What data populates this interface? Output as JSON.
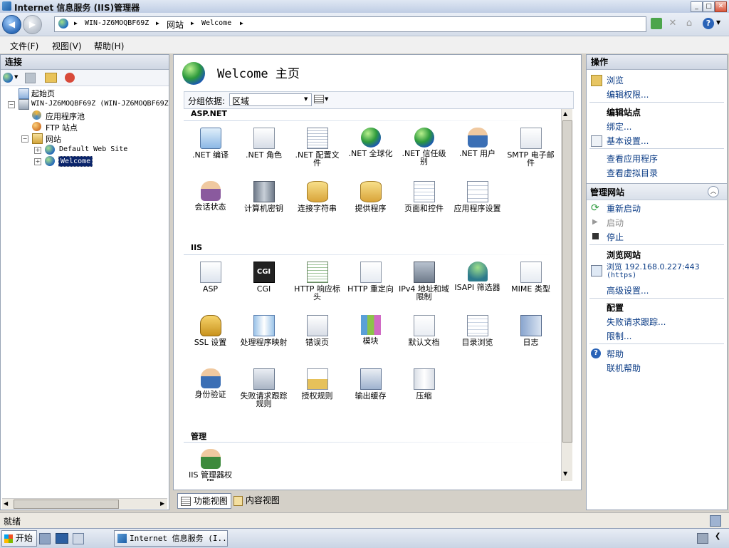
{
  "window": {
    "title": "Internet 信息服务 (IIS)管理器"
  },
  "address": {
    "segments": [
      "WIN-JZ6MOQBF69Z",
      "网站",
      "Welcome"
    ]
  },
  "menu": [
    "文件(F)",
    "视图(V)",
    "帮助(H)"
  ],
  "connections": {
    "title": "连接",
    "tree": [
      {
        "label": "起始页"
      },
      {
        "label": "WIN-JZ6MOQBF69Z (WIN-JZ6MOQBF69Z"
      },
      {
        "label": "应用程序池"
      },
      {
        "label": "FTP 站点"
      },
      {
        "label": "网站"
      },
      {
        "label": "Default Web Site"
      },
      {
        "label": "Welcome",
        "selected": true
      }
    ]
  },
  "center": {
    "title": "Welcome 主页",
    "group_by_label": "分组依据:",
    "group_by_value": "区域",
    "groups": [
      {
        "name": "ASP.NET",
        "items": [
          {
            "label": ".NET 编译",
            "icon": "download-icon"
          },
          {
            "label": ".NET 角色",
            "icon": "documents-icon"
          },
          {
            "label": ".NET 配置文件",
            "icon": "config-file-icon"
          },
          {
            "label": ".NET 全球化",
            "icon": "globe-icon"
          },
          {
            "label": ".NET 信任级别",
            "icon": "trust-globe-icon"
          },
          {
            "label": ".NET 用户",
            "icon": "users-icon"
          },
          {
            "label": "SMTP 电子邮件",
            "icon": "email-icon"
          },
          {
            "label": "会话状态",
            "icon": "session-user-icon"
          },
          {
            "label": "计算机密钥",
            "icon": "server-key-icon"
          },
          {
            "label": "连接字符串",
            "icon": "database-icon"
          },
          {
            "label": "提供程序",
            "icon": "provider-icon"
          },
          {
            "label": "页面和控件",
            "icon": "pages-controls-icon"
          },
          {
            "label": "应用程序设置",
            "icon": "app-settings-icon"
          }
        ]
      },
      {
        "name": "IIS",
        "items": [
          {
            "label": "ASP",
            "icon": "asp-icon"
          },
          {
            "label": "CGI",
            "icon": "cgi-icon"
          },
          {
            "label": "HTTP 响应标头",
            "icon": "http-headers-icon"
          },
          {
            "label": "HTTP 重定向",
            "icon": "redirect-icon"
          },
          {
            "label": "IPv4 地址和域限制",
            "icon": "ip-restrict-icon"
          },
          {
            "label": "ISAPI 筛选器",
            "icon": "isapi-filter-icon"
          },
          {
            "label": "MIME 类型",
            "icon": "mime-icon"
          },
          {
            "label": "SSL 设置",
            "icon": "lock-icon"
          },
          {
            "label": "处理程序映射",
            "icon": "handler-map-icon"
          },
          {
            "label": "错误页",
            "icon": "error-page-icon"
          },
          {
            "label": "模块",
            "icon": "modules-icon"
          },
          {
            "label": "默认文档",
            "icon": "default-doc-icon"
          },
          {
            "label": "目录浏览",
            "icon": "dir-browse-icon"
          },
          {
            "label": "日志",
            "icon": "log-icon"
          },
          {
            "label": "身份验证",
            "icon": "auth-icon"
          },
          {
            "label": "失败请求跟踪规则",
            "icon": "failed-trace-icon"
          },
          {
            "label": "授权规则",
            "icon": "authz-rules-icon"
          },
          {
            "label": "输出缓存",
            "icon": "output-cache-icon"
          },
          {
            "label": "压缩",
            "icon": "compress-icon"
          }
        ]
      },
      {
        "name": "管理",
        "items": [
          {
            "label": "IIS 管理器权限",
            "icon": "iis-managers-icon"
          }
        ]
      }
    ],
    "view_tabs": [
      "功能视图",
      "内容视图"
    ]
  },
  "actions": {
    "title": "操作",
    "browse": "浏览",
    "edit_perms": "编辑权限...",
    "edit_site": "编辑站点",
    "bindings": "绑定...",
    "basic_settings": "基本设置...",
    "view_apps": "查看应用程序",
    "view_vdirs": "查看虚拟目录",
    "manage_site": "管理网站",
    "restart": "重新启动",
    "start": "启动",
    "stop": "停止",
    "browse_site": "浏览网站",
    "browse_addr": "浏览 192.168.0.227:443",
    "browse_proto": "(https)",
    "advanced": "高级设置...",
    "config": "配置",
    "failed_trace": "失败请求跟踪...",
    "limits": "限制...",
    "help": "帮助",
    "online_help": "联机帮助"
  },
  "status": {
    "text": "就绪"
  },
  "taskbar": {
    "start": "开始",
    "task": "Internet 信息服务 (I..."
  }
}
